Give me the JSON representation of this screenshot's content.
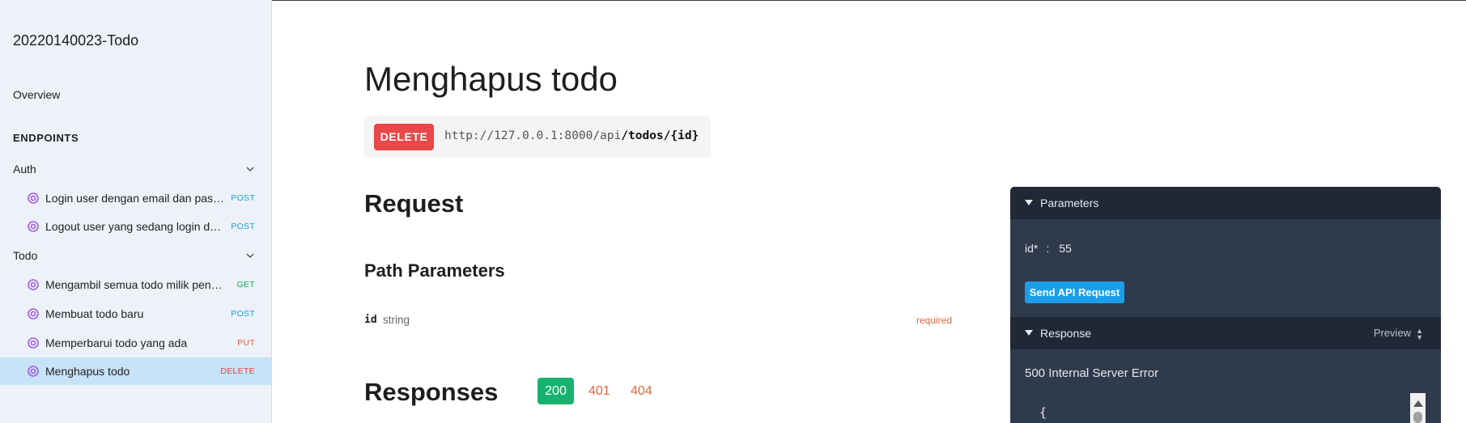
{
  "sidebar": {
    "app_title": "20220140023-Todo",
    "overview": "Overview",
    "endpoints_heading": "ENDPOINTS",
    "groups": [
      {
        "label": "Auth",
        "items": [
          {
            "label": "Login user dengan email dan passw...",
            "method": "POST"
          },
          {
            "label": "Logout user yang sedang login dan ...",
            "method": "POST"
          }
        ]
      },
      {
        "label": "Todo",
        "items": [
          {
            "label": "Mengambil semua todo milik penggu...",
            "method": "GET"
          },
          {
            "label": "Membuat todo baru",
            "method": "POST"
          },
          {
            "label": "Memperbarui todo yang ada",
            "method": "PUT"
          },
          {
            "label": "Menghapus todo",
            "method": "DELETE"
          }
        ]
      }
    ]
  },
  "main": {
    "title": "Menghapus todo",
    "method": "DELETE",
    "url_base": "http://127.0.0.1:8000/api",
    "url_path": "/todos/{id}",
    "request_heading": "Request",
    "path_params_heading": "Path Parameters",
    "params": [
      {
        "name": "id",
        "type": "string",
        "required_label": "required"
      }
    ],
    "responses_heading": "Responses",
    "response_codes": [
      "200",
      "401",
      "404"
    ]
  },
  "try_panel": {
    "parameters_label": "Parameters",
    "param_name": "id*",
    "param_colon": ":",
    "param_value": "55",
    "send_button": "Send API Request",
    "response_label": "Response",
    "preview_label": "Preview",
    "status_text": "500 Internal Server Error",
    "body_start": "{"
  },
  "colors": {
    "sidebar_bg": "#edf1f8",
    "active_item_bg": "#c8e2f7",
    "delete": "#e8484a",
    "post": "#1a9ee8",
    "get": "#1faa5a",
    "put": "#e2673a",
    "success": "#18b270",
    "panel_bg": "#2f3a4b",
    "panel_header_bg": "#1f2836",
    "endpoint_icon": "#a35ee0"
  },
  "icons": {
    "endpoint": "target-icon",
    "collapse": "chevron-down-icon",
    "section_toggle": "triangle-down-icon",
    "sort": "sort-icon"
  }
}
